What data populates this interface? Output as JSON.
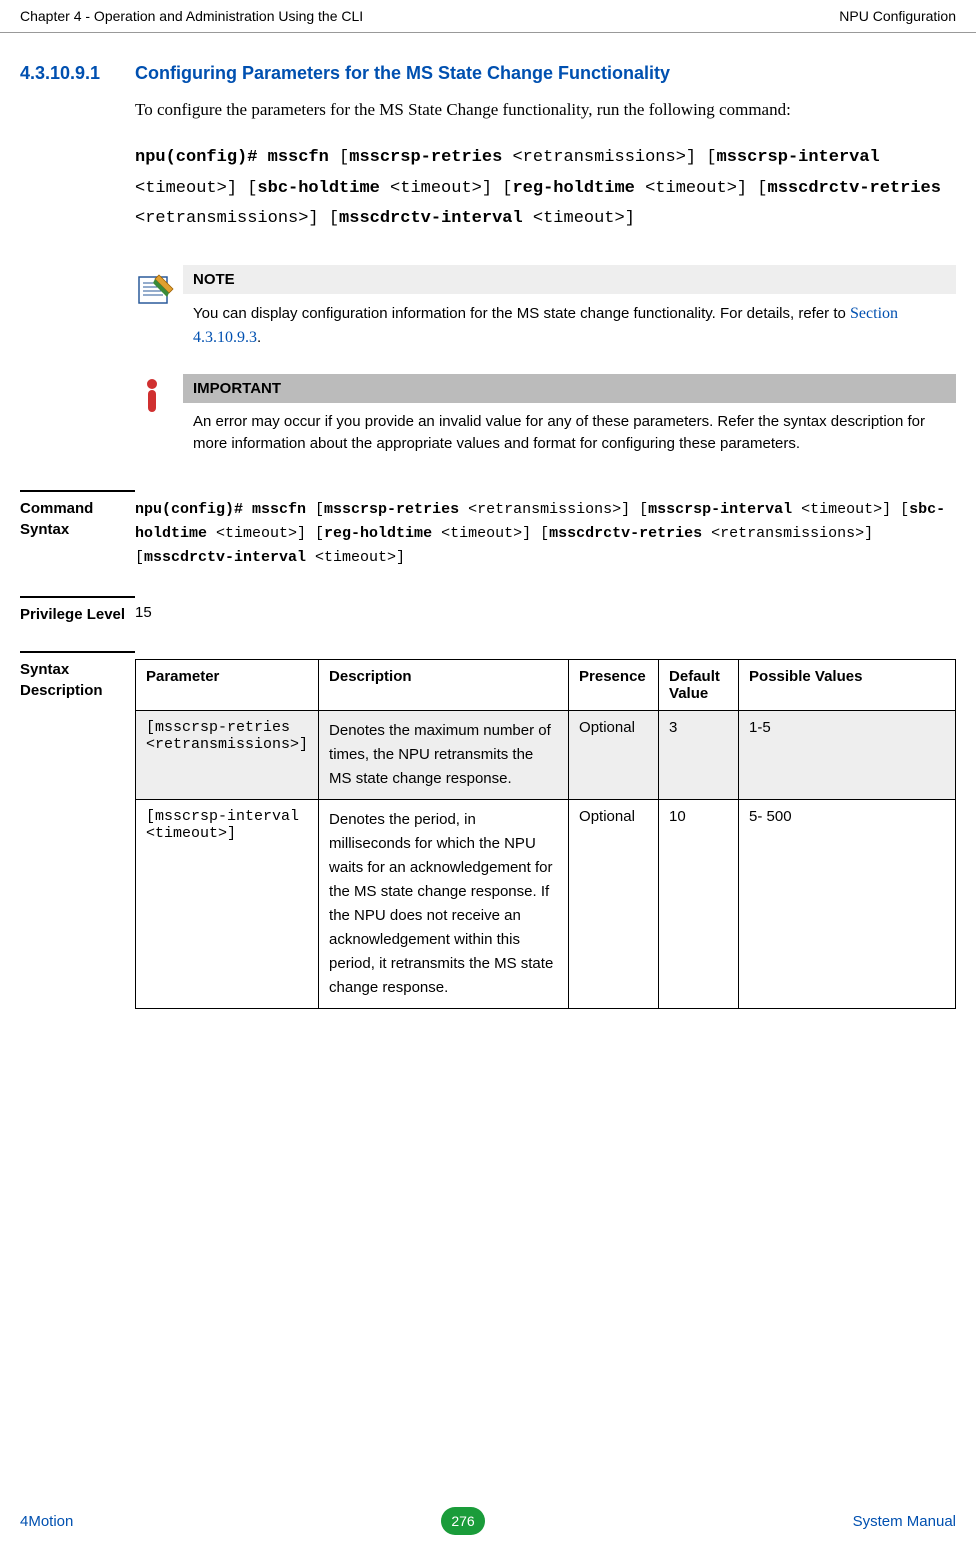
{
  "header": {
    "left": "Chapter 4 - Operation and Administration Using the CLI",
    "right": "NPU Configuration"
  },
  "section": {
    "number": "4.3.10.9.1",
    "title": "Configuring Parameters for the MS State Change Functionality",
    "intro": "To configure the parameters for the MS State Change functionality, run the following command:"
  },
  "command": {
    "p1_bold": "npu(config)# msscfn",
    "p2_plain": " [",
    "p3_bold": "msscrsp-retries",
    "p4_plain": " <retransmissions>] [",
    "p5_bold": "msscrsp-interval",
    "p6_plain": " <timeout>] [",
    "p7_bold": "sbc-holdtime",
    "p8_plain": " <timeout>] [",
    "p9_bold": "reg-holdtime",
    "p10_plain": " <timeout>] [",
    "p11_bold": "msscdrctv-retries",
    "p12_plain": " <retransmissions>] [",
    "p13_bold": "msscdrctv-interval",
    "p14_plain": " <timeout>]"
  },
  "note": {
    "label": "NOTE",
    "body_prefix": "You can display configuration information for the MS state change functionality. For details, refer to ",
    "link": "Section 4.3.10.9.3",
    "body_suffix": "."
  },
  "important": {
    "label": "IMPORTANT",
    "body": "An error may occur if you provide an invalid value for any of these parameters. Refer the syntax description for more information about the appropriate values and format for configuring these parameters."
  },
  "fields": {
    "command_syntax_label": "Command Syntax",
    "privilege_label": "Privilege Level",
    "privilege_value": "15",
    "syntax_desc_label": "Syntax Description"
  },
  "cmd_syntax": {
    "s1_bold": "npu(config)# msscfn",
    "s2_plain": " [",
    "s3_bold": "msscrsp-retries",
    "s4_plain": " <retransmissions>] [",
    "s5_bold": "msscrsp-interval",
    "s6_plain": " <timeout>] [",
    "s7_bold": "sbc-holdtime",
    "s8_plain": " <timeout>] [",
    "s9_bold": "reg-holdtime",
    "s10_plain": " <timeout>] [",
    "s11_bold": "msscdrctv-retries",
    "s12_plain": " <retransmissions>] [",
    "s13_bold": "msscdrctv-interval",
    "s14_plain": " <timeout>]"
  },
  "table": {
    "headers": {
      "parameter": "Parameter",
      "description": "Description",
      "presence": "Presence",
      "default": "Default Value",
      "possible": "Possible Values"
    },
    "rows": [
      {
        "param": "[msscrsp-retries <retransmissions>]",
        "desc": "Denotes the maximum number of times, the NPU retransmits the MS state change response.",
        "presence": "Optional",
        "default": "3",
        "possible": "1-5"
      },
      {
        "param": "[msscrsp-interval <timeout>]",
        "desc": "Denotes the period, in milliseconds for which the NPU waits for an acknowledgement for the MS state change response. If the NPU does not receive an acknowledgement within this period, it retransmits the MS state change response.",
        "presence": "Optional",
        "default": "10",
        "possible": "5- 500"
      }
    ]
  },
  "footer": {
    "left": "4Motion",
    "page": "276",
    "right": "System Manual"
  }
}
